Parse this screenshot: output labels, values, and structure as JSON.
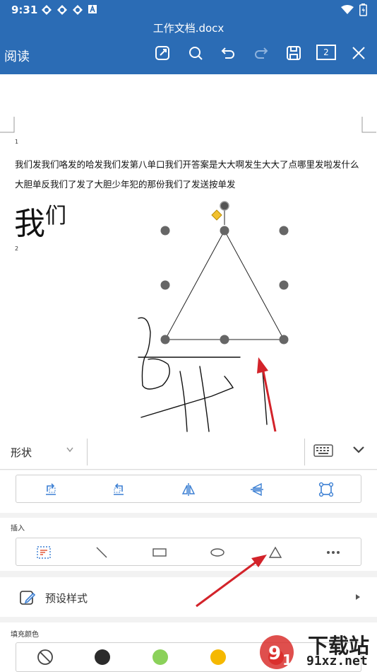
{
  "status_bar": {
    "time": "9:31"
  },
  "header": {
    "doc_title": "工作文档.docx",
    "mode_label": "阅读",
    "page_count": "2",
    "icons": [
      "edit-icon",
      "search-icon",
      "undo-icon",
      "redo-icon",
      "save-icon",
      "page-count-icon",
      "close-icon"
    ]
  },
  "document": {
    "page1_number": "1",
    "page2_number": "2",
    "line1": "我们发我们咯发的哈发我们发第八单口我们开答案是大大啊发生大大了点哪里发啦发什么",
    "line2": "大胆单反我们了发了大胆少年犯的那份我们了发送按单发",
    "big_text_main": "我",
    "big_text_small": "们",
    "selected_shape": "triangle"
  },
  "shape_bar": {
    "label": "形状",
    "keyboard_icon": "keyboard-icon",
    "collapse_icon": "chevron-down-icon"
  },
  "arrange_tools": [
    "bring-forward-icon",
    "send-backward-icon",
    "flip-horizontal-icon",
    "flip-vertical-icon",
    "crop-shape-icon"
  ],
  "insert": {
    "title": "插入",
    "tools": [
      "textbox-icon",
      "line-icon",
      "rectangle-icon",
      "ellipse-icon",
      "triangle-icon",
      "more-icon"
    ]
  },
  "preset": {
    "label": "预设样式"
  },
  "fill": {
    "title": "填充颜色",
    "colors": [
      "none",
      "#2b2b2b",
      "#8bd15a",
      "#f5b800",
      "#e12a2a"
    ]
  },
  "watermark": {
    "text": "下载站",
    "sub": "91xz.net"
  }
}
